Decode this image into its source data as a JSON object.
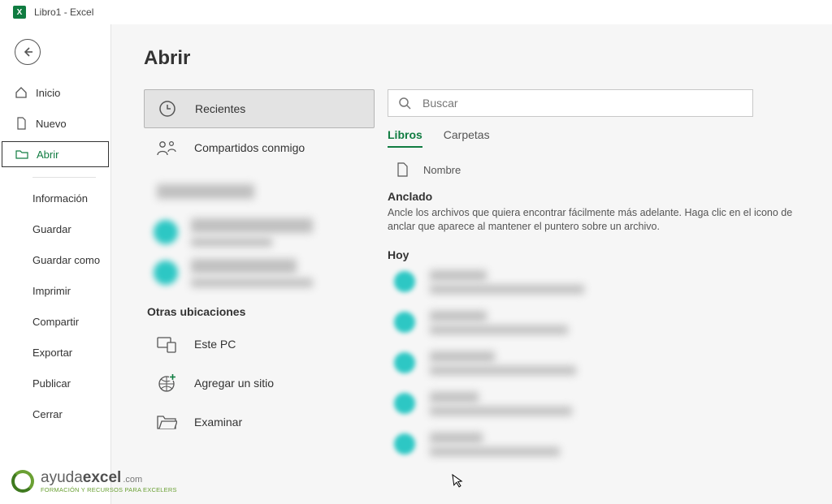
{
  "title": "Libro1  -  Excel",
  "page_title": "Abrir",
  "sidebar": {
    "home": "Inicio",
    "new": "Nuevo",
    "open": "Abrir",
    "info": "Información",
    "save": "Guardar",
    "saveas": "Guardar como",
    "print": "Imprimir",
    "share": "Compartir",
    "export": "Exportar",
    "publish": "Publicar",
    "close": "Cerrar"
  },
  "locations": {
    "recent": "Recientes",
    "shared": "Compartidos conmigo",
    "other_title": "Otras ubicaciones",
    "this_pc": "Este PC",
    "add_place": "Agregar un sitio",
    "browse": "Examinar"
  },
  "filepane": {
    "search_placeholder": "Buscar",
    "tabs": {
      "workbooks": "Libros",
      "folders": "Carpetas"
    },
    "col_name": "Nombre",
    "pinned_title": "Anclado",
    "pinned_desc": "Ancle los archivos que quiera encontrar fácilmente más adelante. Haga clic en el icono de anclar que aparece al mantener el puntero sobre un archivo.",
    "today_title": "Hoy"
  },
  "logo": {
    "brand_a": "ayuda",
    "brand_b": "excel",
    "com": ".com",
    "tagline": "FORMACIÓN Y RECURSOS PARA EXCELERS"
  },
  "colors": {
    "accent": "#107c41"
  }
}
